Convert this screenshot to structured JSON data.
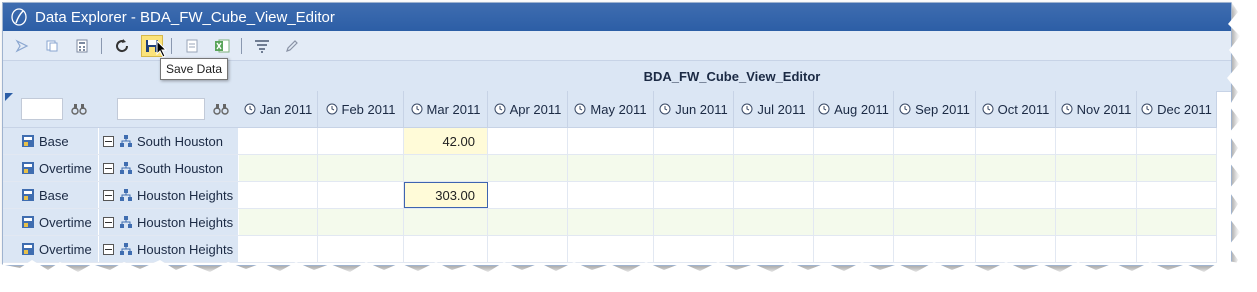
{
  "window": {
    "title": "Data Explorer - BDA_FW_Cube_View_Editor"
  },
  "toolbar": {
    "buttons": [
      {
        "name": "submit-icon"
      },
      {
        "name": "copy-icon"
      },
      {
        "name": "calculate-icon"
      },
      {
        "name": "refresh-icon"
      },
      {
        "name": "save-icon"
      },
      {
        "name": "report-icon"
      },
      {
        "name": "excel-icon"
      },
      {
        "name": "filter-icon"
      },
      {
        "name": "edit-icon"
      }
    ],
    "tooltip": "Save Data"
  },
  "cube_view": {
    "title": "BDA_FW_Cube_View_Editor"
  },
  "columns": [
    "Jan 2011",
    "Feb 2011",
    "Mar 2011",
    "Apr 2011",
    "May 2011",
    "Jun 2011",
    "Jul 2011",
    "Aug 2011",
    "Sep 2011",
    "Oct 2011",
    "Nov 2011",
    "Dec 2011"
  ],
  "rows": [
    {
      "type": "Base",
      "entity": "South Houston",
      "values": [
        "",
        "",
        "42.00",
        "",
        "",
        "",
        "",
        "",
        "",
        "",
        "",
        ""
      ]
    },
    {
      "type": "Overtime",
      "entity": "South Houston",
      "values": [
        "",
        "",
        "",
        "",
        "",
        "",
        "",
        "",
        "",
        "",
        "",
        ""
      ]
    },
    {
      "type": "Base",
      "entity": "Houston Heights",
      "values": [
        "",
        "",
        "303.00",
        "",
        "",
        "",
        "",
        "",
        "",
        "",
        "",
        ""
      ]
    },
    {
      "type": "Overtime",
      "entity": "Houston Heights",
      "values": [
        "",
        "",
        "",
        "",
        "",
        "",
        "",
        "",
        "",
        "",
        "",
        ""
      ]
    },
    {
      "type": "Overtime",
      "entity": "Houston Heights",
      "values": [
        "",
        "",
        "",
        "",
        "",
        "",
        "",
        "",
        "",
        "",
        "",
        ""
      ]
    }
  ]
}
